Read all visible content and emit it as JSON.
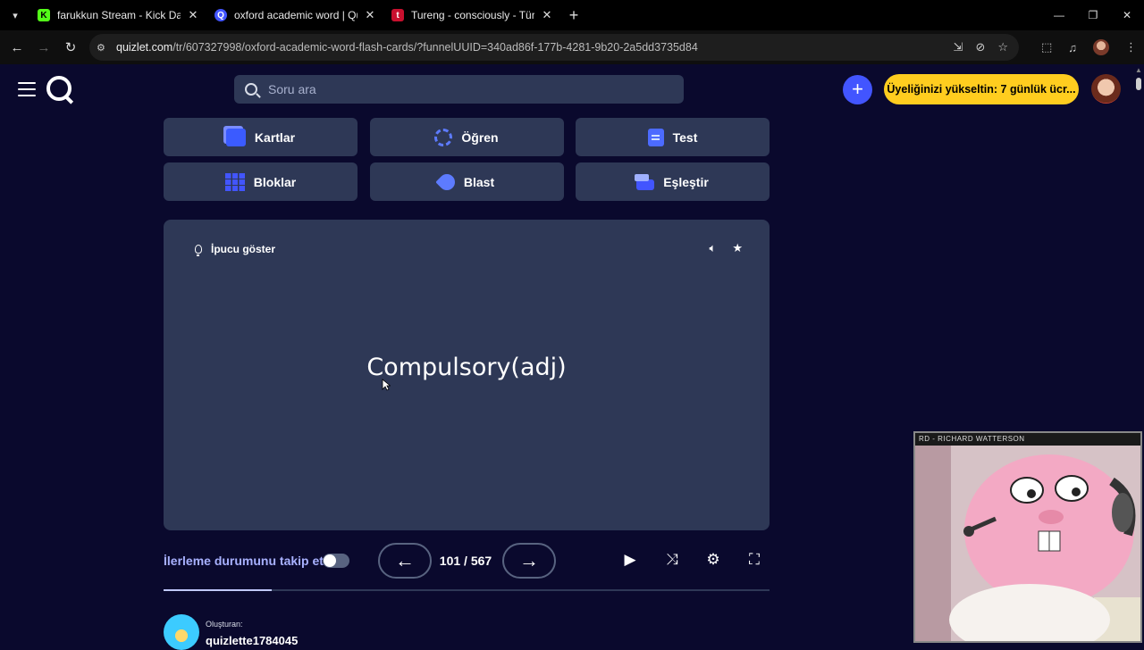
{
  "browser": {
    "tabs": [
      {
        "title": "farukkun Stream - Kick Dashboard",
        "favicon": "K",
        "color": "#53fc18"
      },
      {
        "title": "oxford academic word | Quizlet",
        "favicon": "Q",
        "color": "#4255ff"
      },
      {
        "title": "Tureng - consciously - Türkçe İngilizce",
        "favicon": "t",
        "color": "#c8102e"
      }
    ],
    "url_domain": "quizlet.com",
    "url_path": "/tr/607327998/oxford-academic-word-flash-cards/?funnelUUID=340ad86f-177b-4281-9b20-2a5dd3735d84"
  },
  "header": {
    "search_placeholder": "Soru ara",
    "upgrade_label": "Üyeliğinizi yükseltin: 7 günlük ücr...",
    "accent": "#4255ff",
    "upgrade_color": "#ffcd1f"
  },
  "modes": [
    {
      "label": "Kartlar",
      "icon": "cards-icon"
    },
    {
      "label": "Öğren",
      "icon": "learn-icon"
    },
    {
      "label": "Test",
      "icon": "test-icon"
    },
    {
      "label": "Bloklar",
      "icon": "blocks-icon"
    },
    {
      "label": "Blast",
      "icon": "blast-icon"
    },
    {
      "label": "Eşleştir",
      "icon": "match-icon"
    }
  ],
  "card": {
    "hint_label": "İpucu göster",
    "term": "Compulsory(adj)"
  },
  "controls": {
    "track_progress_label": "İlerleme durumunu takip et",
    "track_progress_on": false,
    "current": 101,
    "total": 567,
    "counter_text": "101 / 567"
  },
  "creator": {
    "label": "Oluşturan:",
    "name": "quizlette1784045"
  },
  "webcam": {
    "caption": "RD - RICHARD WATTERSON"
  }
}
